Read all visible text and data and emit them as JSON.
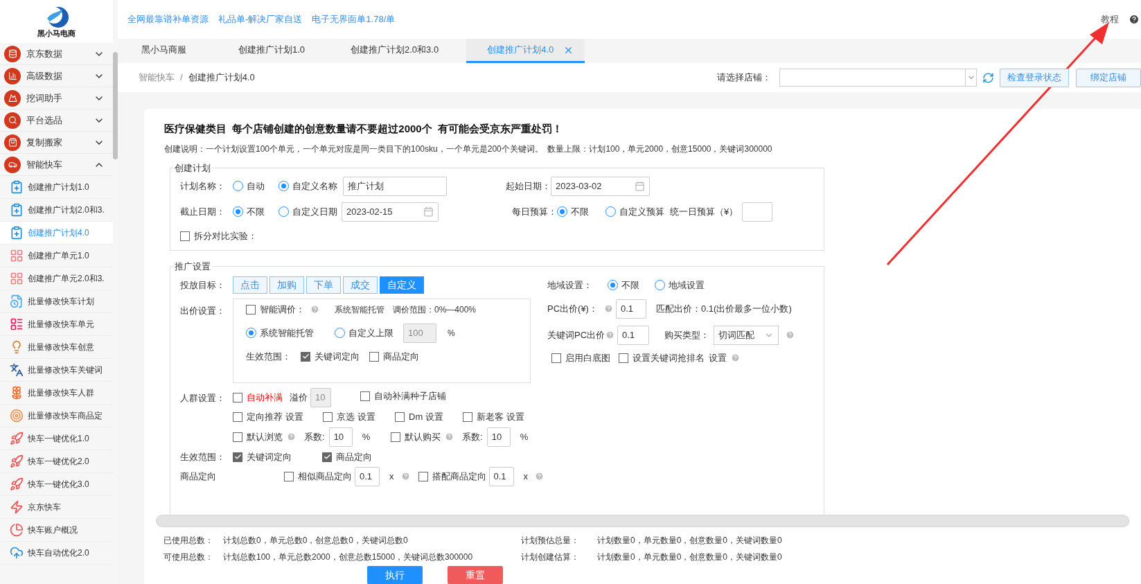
{
  "top_links": [
    "全网最靠谱补单资源",
    "礼品单-解决厂家自送",
    "电子无界面单1.78/单"
  ],
  "help": {
    "label": "教程"
  },
  "logo": {
    "label": "黑小马电商"
  },
  "sidebar": {
    "items": [
      {
        "label": "京东数据",
        "expanded": false
      },
      {
        "label": "高级数据",
        "expanded": false
      },
      {
        "label": "挖词助手",
        "expanded": false
      },
      {
        "label": "平台选品",
        "expanded": false
      },
      {
        "label": "复制搬家",
        "expanded": false
      },
      {
        "label": "智能快车",
        "expanded": true,
        "children": [
          {
            "label": "创建推广计划1.0",
            "selected": false
          },
          {
            "label": "创建推广计划2.0和3.",
            "selected": false
          },
          {
            "label": "创建推广计划4.0",
            "selected": true
          },
          {
            "label": "创建推广单元1.0",
            "selected": false
          },
          {
            "label": "创建推广单元2.0和3.",
            "selected": false
          },
          {
            "label": "批量修改快车计划",
            "selected": false
          },
          {
            "label": "批量修改快车单元",
            "selected": false
          },
          {
            "label": "批量修改快车创意",
            "selected": false
          },
          {
            "label": "批量修改快车关键词",
            "selected": false
          },
          {
            "label": "批量修改快车人群",
            "selected": false
          },
          {
            "label": "批量修改快车商品定",
            "selected": false
          },
          {
            "label": "快车一键优化1.0",
            "selected": false
          },
          {
            "label": "快车一键优化2.0",
            "selected": false
          },
          {
            "label": "快车一键优化3.0",
            "selected": false
          },
          {
            "label": "京东快车",
            "selected": false
          },
          {
            "label": "快车账户概况",
            "selected": false
          },
          {
            "label": "快车自动优化2.0",
            "selected": false
          }
        ]
      }
    ]
  },
  "tabs": [
    {
      "label": "黑小马商服",
      "selected": false,
      "closable": false
    },
    {
      "label": "创建推广计划1.0",
      "selected": false,
      "closable": false
    },
    {
      "label": "创建推广计划2.0和3.0",
      "selected": false,
      "closable": false
    },
    {
      "label": "创建推广计划4.0",
      "selected": true,
      "closable": true
    }
  ],
  "breadcrumb": [
    "智能快车",
    "创建推广计划4.0"
  ],
  "breadcrumb_separator": "/",
  "shop": {
    "label": "请选择店铺：",
    "buttons": [
      "检查登录状态",
      "绑定店铺"
    ]
  },
  "notice": {
    "title": "医疗保健类目  每个店铺创建的创意数量请不要超过2000个  有可能会受京东严重处罚！",
    "description": "创建说明：一个计划设置100个单元，一个单元对应是同一类目下的100sku，一个单元是200个关键词。  数量上限：计划100，单元2000，创意15000，关键词300000"
  },
  "create_plan": {
    "legend": "创建计划",
    "plan_name": {
      "label": "计划名称：",
      "options": [
        {
          "label": "自动",
          "selected": false
        },
        {
          "label": "自定义名称",
          "selected": true
        }
      ],
      "value": "推广计划"
    },
    "start_date": {
      "label": "起始日期：",
      "value": "2023-03-02"
    },
    "end_date": {
      "label": "截止日期：",
      "options": [
        {
          "label": "不限",
          "selected": true
        },
        {
          "label": "自定义日期",
          "selected": false
        }
      ],
      "value": "2023-02-15"
    },
    "daily_budget": {
      "label": "每日预算：",
      "options": [
        {
          "label": "不限",
          "selected": true
        },
        {
          "label": "自定义预算",
          "selected": false
        }
      ],
      "input_label": "统一日预算（¥）"
    },
    "split_test": {
      "label": "拆分对比实验：",
      "checked": false
    }
  },
  "promotion": {
    "legend": "推广设置",
    "target": {
      "label": "投放目标：",
      "options": [
        {
          "label": "点击",
          "selected": false
        },
        {
          "label": "加购",
          "selected": false
        },
        {
          "label": "下单",
          "selected": false
        },
        {
          "label": "成交",
          "selected": false
        },
        {
          "label": "自定义",
          "selected": true
        }
      ]
    },
    "bid": {
      "label": "出价设置：",
      "smart": {
        "label": "智能调价：",
        "checked": false
      },
      "smart_note": "系统智能托管",
      "range": "调价范围：0%—400%",
      "modes": [
        {
          "label": "系统智能托管",
          "selected": true
        },
        {
          "label": "自定义上限",
          "selected": false
        }
      ],
      "limit": {
        "value": "100",
        "disabled": true
      },
      "unit": "%",
      "scope_label": "生效范围：",
      "scope": [
        {
          "label": "关键词定向",
          "checked": true
        },
        {
          "label": "商品定向",
          "checked": false
        }
      ]
    },
    "region": {
      "label": "地域设置：",
      "options": [
        {
          "label": "不限",
          "selected": true
        },
        {
          "label": "地域设置",
          "selected": false
        }
      ]
    },
    "pc_bid": {
      "label": "PC出价(¥)：",
      "value": "0.1",
      "note": "匹配出价：0.1(出价最多一位小数)"
    },
    "keyword_bid": {
      "label": "关键词PC出价",
      "value": "0.1",
      "buy_type_label": "购买类型：",
      "buy_type": "切词匹配"
    },
    "extras": [
      {
        "label": "启用白底图",
        "checked": false
      },
      {
        "label": "设置关键词抢排名",
        "checked": false,
        "link": "设置"
      }
    ],
    "crowd": {
      "label": "人群设置：",
      "auto_fill": {
        "label": "自动补满",
        "checked": false
      },
      "premium_label": "溢价",
      "premium": "10",
      "seed": {
        "label": "自动补满种子店铺",
        "checked": false
      },
      "targets": [
        {
          "label": "定向推荐",
          "checked": false,
          "link": "设置"
        },
        {
          "label": "京选",
          "checked": false,
          "link": "设置"
        },
        {
          "label": "Dm",
          "checked": false,
          "link": "设置"
        },
        {
          "label": "新老客",
          "checked": false,
          "link": "设置"
        }
      ],
      "defaults": [
        {
          "label": "默认浏览",
          "checked": false,
          "coef_label": "系数:",
          "coef": "10",
          "unit": "%"
        },
        {
          "label": "默认购买",
          "checked": false,
          "coef_label": "系数:",
          "coef": "10",
          "unit": "%"
        }
      ]
    },
    "scope": {
      "label": "生效范围：",
      "items": [
        {
          "label": "关键词定向",
          "checked": true
        },
        {
          "label": "商品定向",
          "checked": true
        }
      ]
    },
    "product_targeting": {
      "label": "商品定向",
      "items": [
        {
          "label": "相似商品定向",
          "checked": false,
          "value": "0.1",
          "unit": "x"
        },
        {
          "label": "搭配商品定向",
          "checked": false,
          "value": "0.1",
          "unit": "x"
        }
      ]
    }
  },
  "stats": [
    {
      "label": "已使用总数：",
      "value": "计划总数0，单元总数0，创意总数0，关键词总数0"
    },
    {
      "label": "计划预估总量：",
      "value": "计划数量0，单元数量0，创意数量0，关键词数量0"
    },
    {
      "label": "可使用总数：",
      "value": "计划总数100，单元总数2000，创意总数15000，关键词总数300000"
    },
    {
      "label": "计划创建估算：",
      "value": "计划数量0，单元数量0，创意数量0，关键词数量0"
    }
  ],
  "actions": [
    {
      "label": "执行",
      "kind": "primary"
    },
    {
      "label": "重置",
      "kind": "danger"
    }
  ]
}
